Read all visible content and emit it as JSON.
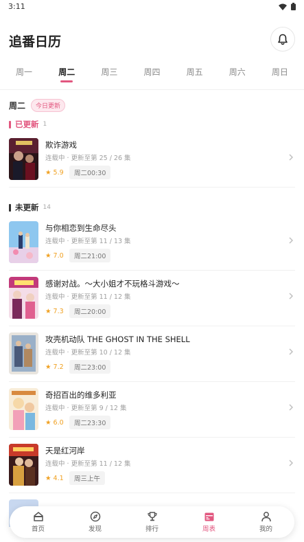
{
  "status": {
    "time": "3:11"
  },
  "header": {
    "title": "追番日历"
  },
  "week_tabs": [
    "周一",
    "周二",
    "周三",
    "周四",
    "周五",
    "周六",
    "周日"
  ],
  "day": {
    "label": "周二",
    "badge": "今日更新"
  },
  "updated_section": {
    "title": "已更新",
    "count": "1"
  },
  "pending_section": {
    "title": "未更新",
    "count": "14"
  },
  "updated": [
    {
      "title": "欺诈游戏",
      "status": "连载中",
      "progress": "更新至第 25 / 26 集",
      "rating": "5.9",
      "time": "周二00:30"
    }
  ],
  "pending": [
    {
      "title": "与你相恋到生命尽头",
      "status": "连载中",
      "progress": "更新至第 11 / 13 集",
      "rating": "7.0",
      "time": "周二21:00"
    },
    {
      "title": "感谢对战。～大小姐才不玩格斗游戏～",
      "status": "连载中",
      "progress": "更新至第 11 / 12 集",
      "rating": "7.3",
      "time": "周二20:00"
    },
    {
      "title": "攻壳机动队 THE GHOST IN THE SHELL",
      "status": "连载中",
      "progress": "更新至第 10 / 12 集",
      "rating": "7.2",
      "time": "周二23:00"
    },
    {
      "title": "奇招百出的维多利亚",
      "status": "连载中",
      "progress": "更新至第 9 / 12 集",
      "rating": "6.0",
      "time": "周二23:30"
    },
    {
      "title": "天是红河岸",
      "status": "连载中",
      "progress": "更新至第 11 / 12 集",
      "rating": "4.1",
      "time": "周三上午"
    }
  ],
  "tabbar": [
    {
      "label": "首页",
      "icon": "home-icon"
    },
    {
      "label": "发现",
      "icon": "compass-icon"
    },
    {
      "label": "排行",
      "icon": "trophy-icon"
    },
    {
      "label": "周表",
      "icon": "calendar-icon",
      "active": true
    },
    {
      "label": "我的",
      "icon": "user-icon"
    }
  ],
  "colors": {
    "accent": "#e2577f",
    "star": "#f0a020"
  }
}
